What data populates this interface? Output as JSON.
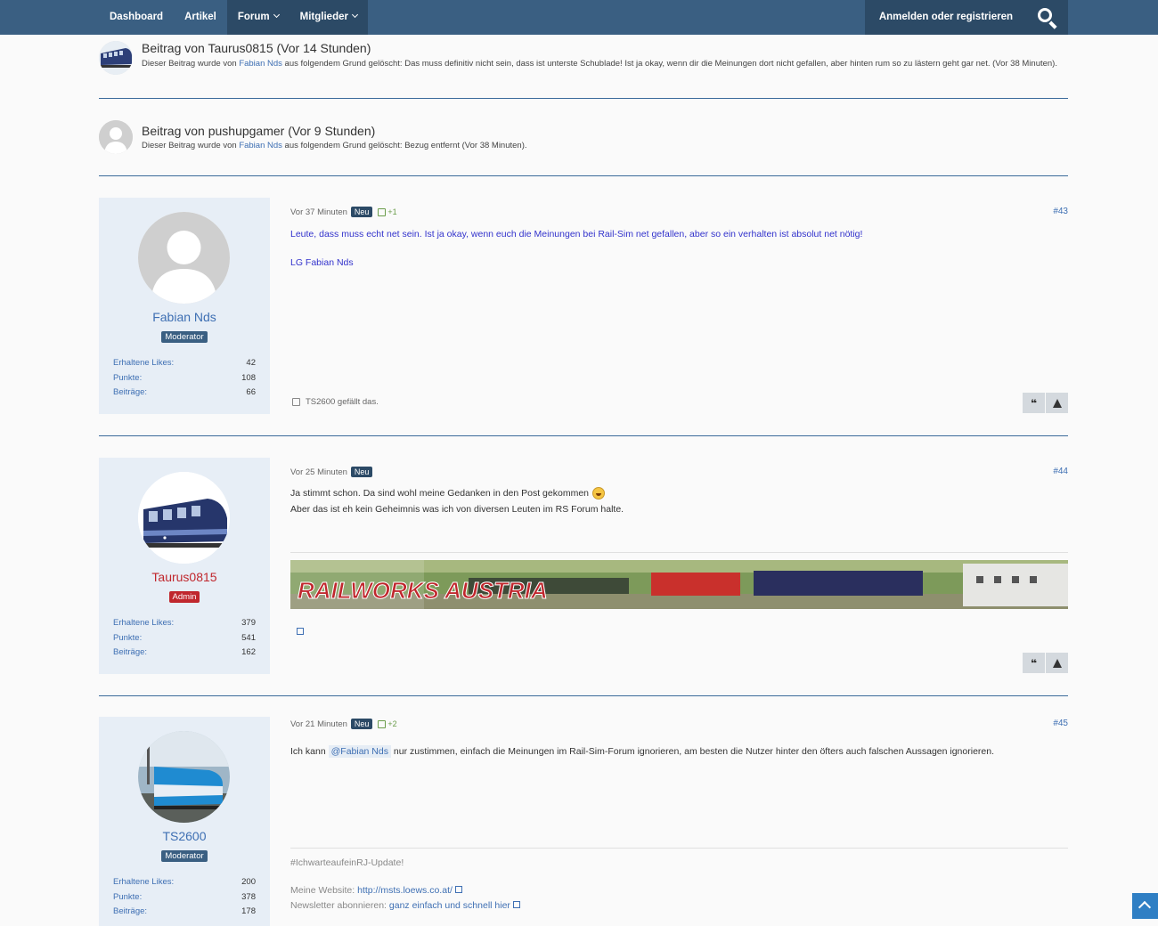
{
  "nav": {
    "dashboard": "Dashboard",
    "articles": "Artikel",
    "forum": "Forum",
    "members": "Mitglieder",
    "login": "Anmelden oder registrieren"
  },
  "deleted_posts": [
    {
      "title": "Beitrag von Taurus0815 (Vor 14 Stunden)",
      "reason_prefix": "Dieser Beitrag wurde von",
      "moderator": "Fabian Nds",
      "reason_text": "aus folgendem Grund gelöscht: Das muss definitiv nicht sein, dass ist unterste Schublade! Ist ja okay, wenn dir die Meinungen dort nicht gefallen, aber hinten rum so zu lästern geht gar net. (Vor 38 Minuten)."
    },
    {
      "title": "Beitrag von pushupgamer (Vor 9 Stunden)",
      "reason_prefix": "Dieser Beitrag wurde von",
      "moderator": "Fabian Nds",
      "reason_text": "aus folgendem Grund gelöscht: Bezug entfernt (Vor 38 Minuten)."
    }
  ],
  "stat_labels": {
    "likes": "Erhaltene Likes:",
    "points": "Punkte:",
    "posts": "Beiträge:"
  },
  "posts": [
    {
      "author": "Fabian Nds",
      "rank": "Moderator",
      "likes": "42",
      "points": "108",
      "posts": "66",
      "time": "Vor 37 Minuten",
      "badge": "Neu",
      "reactions": "+1",
      "number": "#43",
      "line1": "Leute, dass muss echt net sein. Ist ja okay, wenn euch die Meinungen bei Rail-Sim net gefallen, aber so ein verhalten ist absolut net nötig!",
      "line2": "LG Fabian Nds",
      "liked_by": "TS2600 gefällt das."
    },
    {
      "author": "Taurus0815",
      "rank": "Admin",
      "likes": "379",
      "points": "541",
      "posts": "162",
      "time": "Vor 25 Minuten",
      "badge": "Neu",
      "number": "#44",
      "line1": "Ja stimmt schon. Da sind wohl meine Gedanken in den Post gekommen",
      "line2": "Aber das ist eh kein Geheimnis was ich von diversen Leuten im RS Forum halte.",
      "banner_text": "RAILWORKS AUSTRIA"
    },
    {
      "author": "TS2600",
      "rank": "Moderator",
      "likes": "200",
      "points": "378",
      "posts": "178",
      "time": "Vor 21 Minuten",
      "badge": "Neu",
      "reactions": "+2",
      "number": "#45",
      "msg_prefix": "Ich kann",
      "mention": "@Fabian Nds",
      "msg_suffix": "nur zustimmen, einfach die Meinungen im Rail-Sim-Forum ignorieren, am besten die Nutzer hinter den öfters auch falschen Aussagen ignorieren.",
      "sig_hashtag": "#IchwarteaufeinRJ-Update!",
      "sig_website_label": "Meine Website:",
      "sig_website_url": "http://msts.loews.co.at/",
      "sig_newsletter_label": "Newsletter abonnieren:",
      "sig_newsletter_link": "ganz einfach und schnell hier"
    }
  ],
  "icons": {
    "search": "search-icon",
    "quote": "quote-icon",
    "report": "warning-icon",
    "like": "thumbs-up-icon",
    "scroll_top": "chevron-up-icon",
    "external": "external-link-icon"
  },
  "colors": {
    "topbar": "#3a5f82",
    "link": "#3e6fb3",
    "admin": "#c0272d",
    "highlight_text": "#3333cc"
  }
}
